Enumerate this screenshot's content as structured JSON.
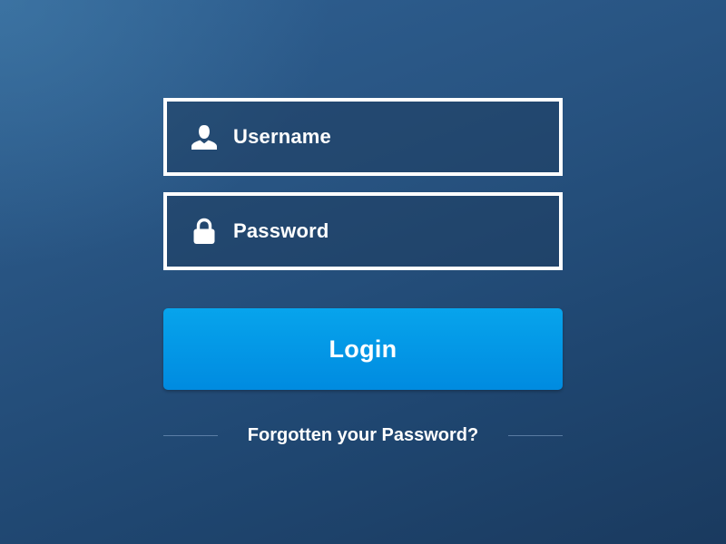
{
  "login_form": {
    "username": {
      "placeholder": "Username",
      "icon": "user-icon"
    },
    "password": {
      "placeholder": "Password",
      "icon": "lock-icon"
    },
    "login_label": "Login",
    "forgot_link": "Forgotten your Password?"
  },
  "colors": {
    "background_top": "#2f6092",
    "background_bottom": "#1a3a5f",
    "button": "#0098e6",
    "field_border": "#ffffff",
    "text": "#ffffff"
  }
}
